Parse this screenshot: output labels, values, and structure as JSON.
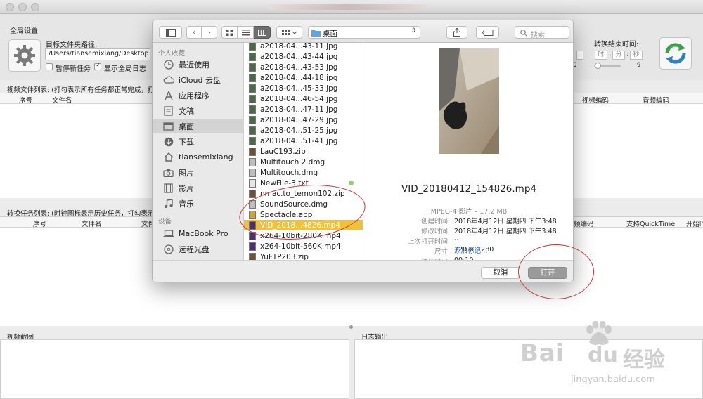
{
  "background_app": {
    "global_settings": "全局设置",
    "target_folder_label": "目标文件夹路径:",
    "target_folder_value": "/Users/tiansemixiang/Desktop",
    "pause_new_tasks": "暂停新任务",
    "show_global_log": "显示全局日志",
    "end_time_label": "转换结束时间:",
    "end_time_fields": [
      "时",
      "分",
      "秒"
    ],
    "slider_zero": "0",
    "slider_max": "9",
    "video_list_caption": "视频文件列表: (打勾表示所有任务都正常完成，打",
    "video_list_cols": [
      "序号",
      "文件名",
      "视频编码",
      "音频编码"
    ],
    "task_list_caption": "转换任务列表: (时钟图标表示历史任务，打勾表示",
    "task_list_cols": [
      "序号",
      "文件名",
      "文件",
      "频编码",
      "支持QuickTime",
      "开始时"
    ],
    "screenshot_pane": "视频截图",
    "log_pane": "日志输出",
    "colors": {
      "accent_gear": "#7a7a7a",
      "refresh_green": "#3aa34a",
      "refresh_blue": "#2b82c9"
    }
  },
  "dialog": {
    "location": "桌面",
    "search_placeholder": "搜索",
    "sidebar": {
      "favorites_title": "个人收藏",
      "favorites": [
        {
          "label": "最近使用",
          "icon": "clock-icon"
        },
        {
          "label": "iCloud 云盘",
          "icon": "cloud-icon"
        },
        {
          "label": "应用程序",
          "icon": "apps-icon"
        },
        {
          "label": "文稿",
          "icon": "documents-icon"
        },
        {
          "label": "桌面",
          "icon": "desktop-icon"
        },
        {
          "label": "下载",
          "icon": "download-icon"
        },
        {
          "label": "tiansemixiang",
          "icon": "home-icon"
        },
        {
          "label": "图片",
          "icon": "camera-icon"
        },
        {
          "label": "影片",
          "icon": "film-icon"
        },
        {
          "label": "音乐",
          "icon": "music-icon"
        }
      ],
      "devices_title": "设备",
      "devices": [
        {
          "label": "MacBook Pro",
          "icon": "laptop-icon"
        },
        {
          "label": "远程光盘",
          "icon": "disc-icon"
        }
      ]
    },
    "files": [
      {
        "name": "a2018-04...43-11.jpg",
        "icon": "image-file-icon"
      },
      {
        "name": "a2018-04...43-44.jpg",
        "icon": "image-file-icon"
      },
      {
        "name": "a2018-04...43-53.jpg",
        "icon": "image-file-icon"
      },
      {
        "name": "a2018-04...44-18.jpg",
        "icon": "image-file-icon"
      },
      {
        "name": "a2018-04...45-33.jpg",
        "icon": "image-file-icon"
      },
      {
        "name": "a2018-04...46-54.jpg",
        "icon": "image-file-icon"
      },
      {
        "name": "a2018-04...47-11.jpg",
        "icon": "image-file-icon"
      },
      {
        "name": "a2018-04...47-29.jpg",
        "icon": "image-file-icon"
      },
      {
        "name": "a2018-04...51-25.jpg",
        "icon": "image-file-icon"
      },
      {
        "name": "a2018-04...51-41.jpg",
        "icon": "image-file-icon"
      },
      {
        "name": "LauC193.zip",
        "icon": "zip-file-icon"
      },
      {
        "name": "Multitouch 2.dmg",
        "icon": "dmg-file-icon"
      },
      {
        "name": "Multitouch.dmg",
        "icon": "dmg-file-icon"
      },
      {
        "name": "NewFile-3.txt",
        "icon": "text-file-icon",
        "tag": "green"
      },
      {
        "name": "nmac.to_temon102.zip",
        "icon": "zip-file-icon"
      },
      {
        "name": "SoundSource.dmg",
        "icon": "dmg-file-icon"
      },
      {
        "name": "Spectacle.app",
        "icon": "app-file-icon"
      },
      {
        "name": "VID_2018...4826.mp4",
        "icon": "video-file-icon",
        "selected": true
      },
      {
        "name": "x264-10bit-280K.mp4",
        "icon": "video-file-icon"
      },
      {
        "name": "x264-10bit-560K.mp4",
        "icon": "video-file-icon"
      },
      {
        "name": "YuFTP203.zip",
        "icon": "zip-file-icon"
      }
    ],
    "preview": {
      "filename": "VID_20180412_154826.mp4",
      "kind": "MPEG-4 影片 – 17.2 MB",
      "info": [
        {
          "key": "创建时间",
          "value": "2018年4月12日 星期四 下午3:48"
        },
        {
          "key": "修改时间",
          "value": "2018年4月12日 星期四 下午3:48"
        },
        {
          "key": "上次打开时间",
          "value": "--"
        },
        {
          "key": "尺寸",
          "value": "720 × 1280"
        },
        {
          "key": "持续时间",
          "value": "00:10"
        }
      ],
      "add_tags": "添加标记…"
    },
    "cancel": "取消",
    "open": "打开"
  },
  "watermark": {
    "brand": "Bai",
    "brand_du": "du",
    "brand_cn": "经验",
    "url": "jingyan.baidu.com"
  }
}
